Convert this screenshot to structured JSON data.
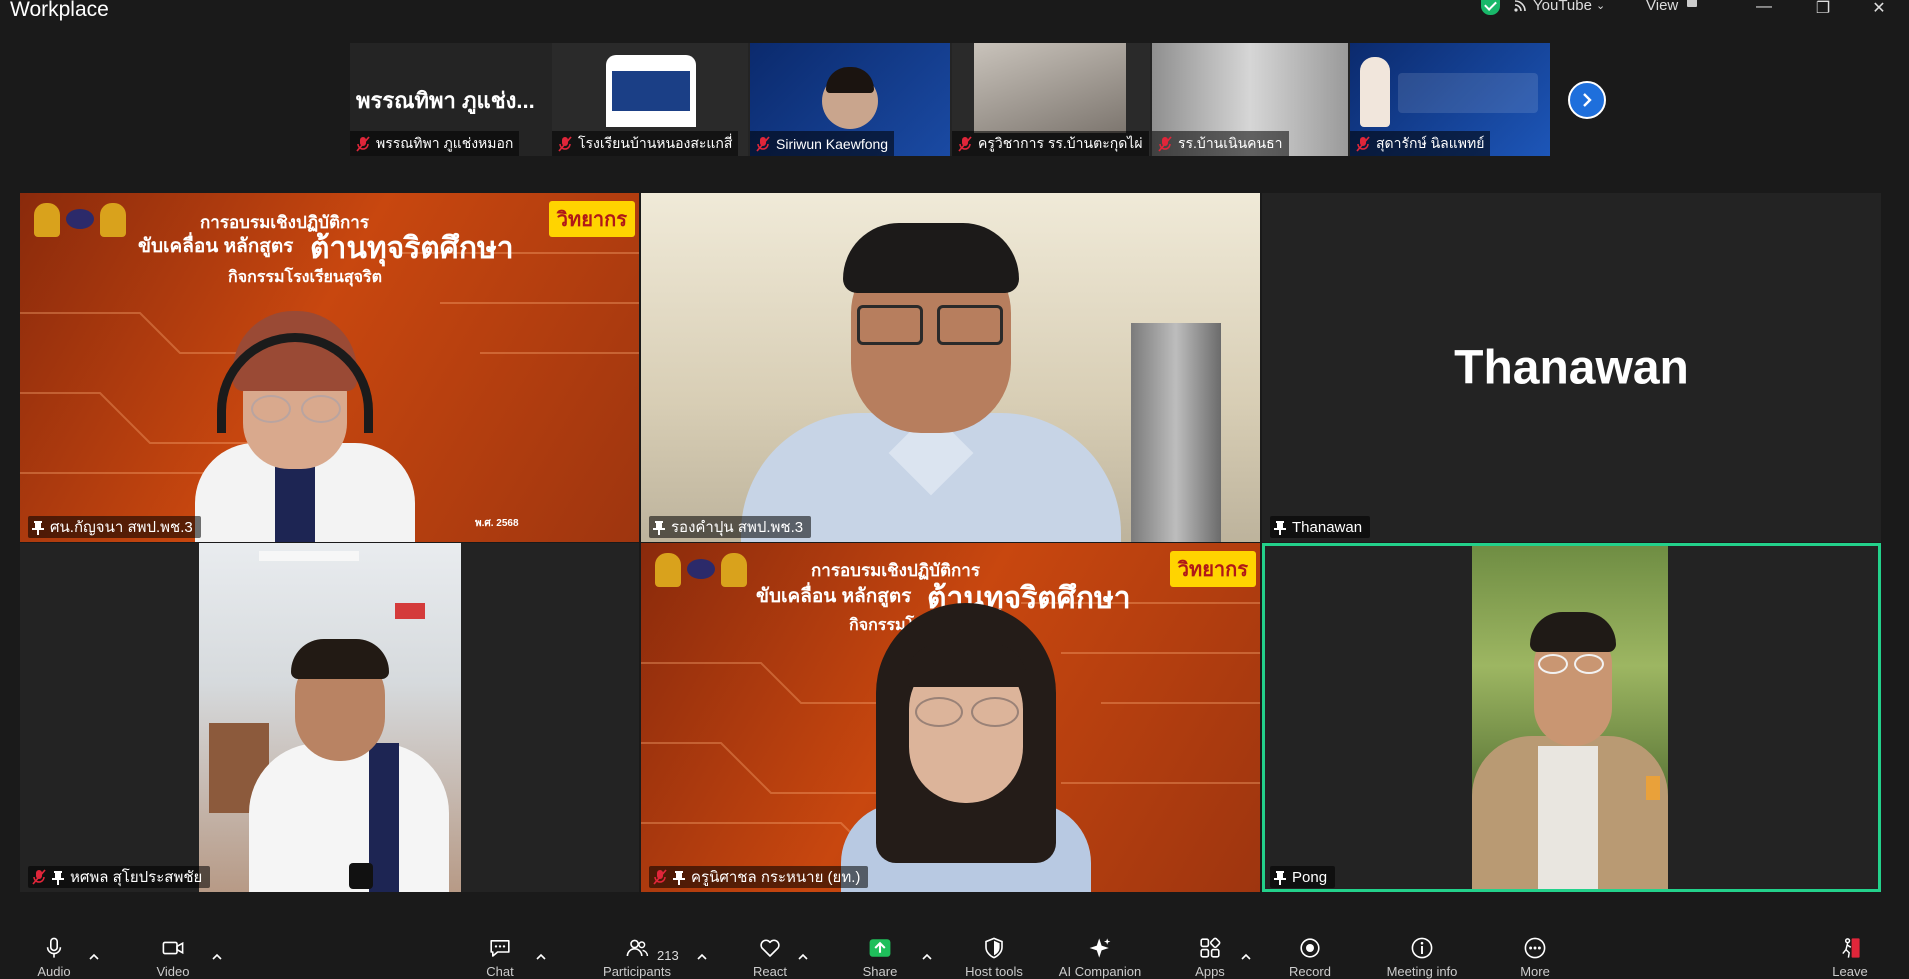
{
  "window": {
    "title": "Workplace",
    "youtube_label": "YouTube",
    "view_label": "View",
    "minimize": "—",
    "maximize": "❐",
    "close": "✕"
  },
  "filmstrip": {
    "items": [
      {
        "name": "พรรณทิพา ภูแช่งหมอก",
        "display_name": "พรรณทิพา ภูแช่ง...",
        "muted": true
      },
      {
        "name": "โรงเรียนบ้านหนองสะแกสี่",
        "muted": true
      },
      {
        "name": "Siriwun Kaewfong",
        "muted": true
      },
      {
        "name": "ครูวิชาการ รร.บ้านตะกุดไผ่",
        "muted": true
      },
      {
        "name": "รร.บ้านเนินคนธา",
        "muted": true
      },
      {
        "name": "สุดารักษ์ นิลแพทย์",
        "muted": true
      }
    ]
  },
  "slide": {
    "badge": "วิทยากร",
    "line1": "การอบรมเชิงปฏิบัติการ",
    "line2a": "ขับเคลื่อน หลักสูตร",
    "line2b": "ต้านทุจริตศึกษา",
    "line3": "กิจกรรมโรงเรียนสุจริต",
    "footer": "พ.ศ. 2568"
  },
  "tiles": [
    {
      "name": "ศน.กัญจนา สพป.พช.3",
      "pinned": true,
      "muted": false
    },
    {
      "name": "รองคำปุน สพป.พช.3",
      "pinned": true,
      "muted": false
    },
    {
      "name": "Thanawan",
      "pinned": true,
      "muted": false,
      "big_label": "Thanawan"
    },
    {
      "name": "หศพล สุโยประสพชัย",
      "pinned": true,
      "muted": true
    },
    {
      "name": "ครูนิศาชล กระหนาย (ยท.)",
      "pinned": true,
      "muted": true
    },
    {
      "name": "Pong",
      "pinned": true,
      "muted": false,
      "active_speaker": true
    }
  ],
  "toolbar": {
    "audio": "Audio",
    "video": "Video",
    "chat": "Chat",
    "participants": "Participants",
    "participants_count": "213",
    "react": "React",
    "share": "Share",
    "host_tools": "Host tools",
    "ai_companion": "AI Companion",
    "apps": "Apps",
    "record": "Record",
    "meeting_info": "Meeting info",
    "more": "More",
    "leave": "Leave"
  },
  "colors": {
    "background": "#1a1a1a",
    "tile": "#232323",
    "active_speaker": "#23d18b",
    "accent_blue": "#1e6fdc",
    "share_green": "#1fbf5b",
    "leave_red": "#e0263a",
    "slide_orange": "#c8470f",
    "badge_yellow": "#ffd400"
  }
}
